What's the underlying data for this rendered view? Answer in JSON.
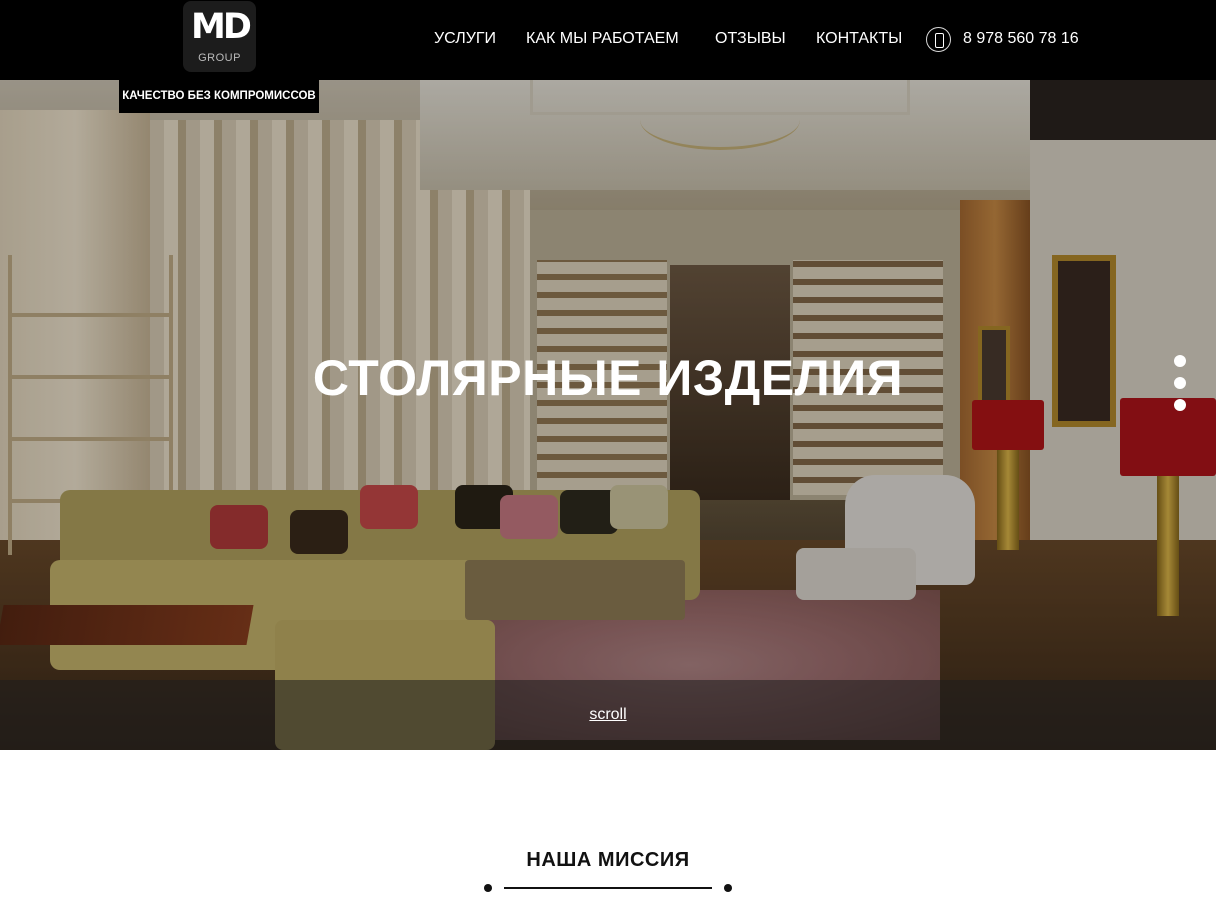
{
  "brand": {
    "logo_mark": "MD",
    "logo_sub": "GROUP",
    "slogan": "КАЧЕСТВО БЕЗ КОМПРОМИССОВ"
  },
  "nav": {
    "items": [
      {
        "label": "УСЛУГИ"
      },
      {
        "label": "КАК МЫ РАБОТАЕМ"
      },
      {
        "label": "ОТЗЫВЫ"
      },
      {
        "label": "КОНТАКТЫ"
      }
    ],
    "phone": "8 978 560 78 16"
  },
  "hero": {
    "title": "СТОЛЯРНЫЕ ИЗДЕЛИЯ",
    "scroll_label": "scroll",
    "slide_count": 3
  },
  "mission": {
    "title": "НАША МИССИЯ"
  }
}
